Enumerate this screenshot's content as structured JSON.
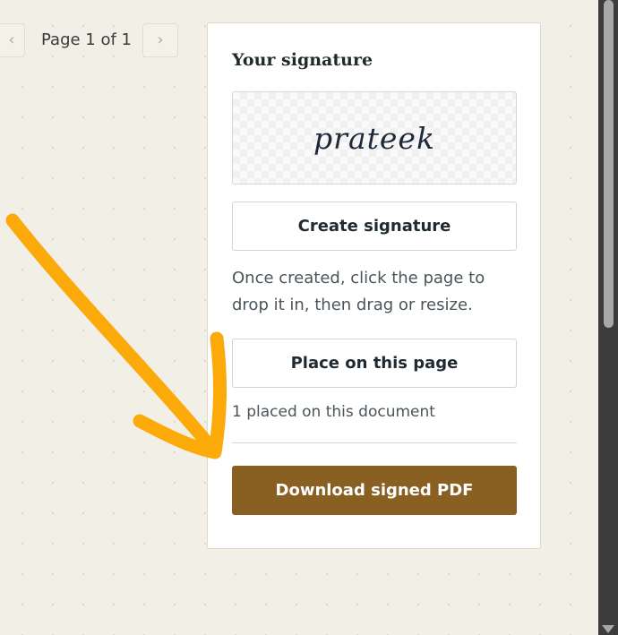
{
  "pager": {
    "prev_icon": "‹",
    "next_icon": "›",
    "label": "Page 1 of 1"
  },
  "panel": {
    "title": "Your signature",
    "signature_text": "prateek",
    "create_label": "Create signature",
    "help_text": "Once created, click the page to drop it in, then drag or resize.",
    "place_label": "Place on this page",
    "placed_count_text": "1 placed on this document",
    "download_label": "Download signed PDF"
  },
  "colors": {
    "accent": "#8a5f22",
    "annotation_arrow": "#fbaa0a",
    "background": "#f2efe6"
  }
}
